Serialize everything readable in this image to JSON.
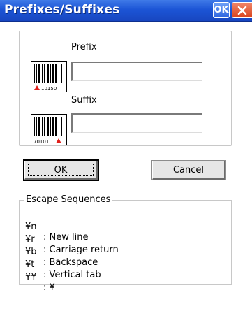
{
  "window": {
    "title": "Prefixes/Suffixes",
    "ok_label": "OK"
  },
  "prefix": {
    "label": "Prefix",
    "value": "",
    "icon_caption": "10150"
  },
  "suffix": {
    "label": "Suffix",
    "value": "",
    "icon_caption": "70101"
  },
  "buttons": {
    "ok_label": "OK",
    "cancel_label": "Cancel"
  },
  "escape_sequences": {
    "title": "Escape Sequences",
    "items": [
      {
        "seq": "¥n",
        "desc": ": New line"
      },
      {
        "seq": "¥r",
        "desc": ": Carriage return"
      },
      {
        "seq": "¥b",
        "desc": ": Backspace"
      },
      {
        "seq": "¥t",
        "desc": ": Vertical tab"
      },
      {
        "seq": "¥¥",
        "desc": ": ¥"
      }
    ]
  },
  "colors": {
    "titlebar": "#1c55d6",
    "close_button": "#d9431c",
    "barcode_marker": "#e0201c"
  }
}
